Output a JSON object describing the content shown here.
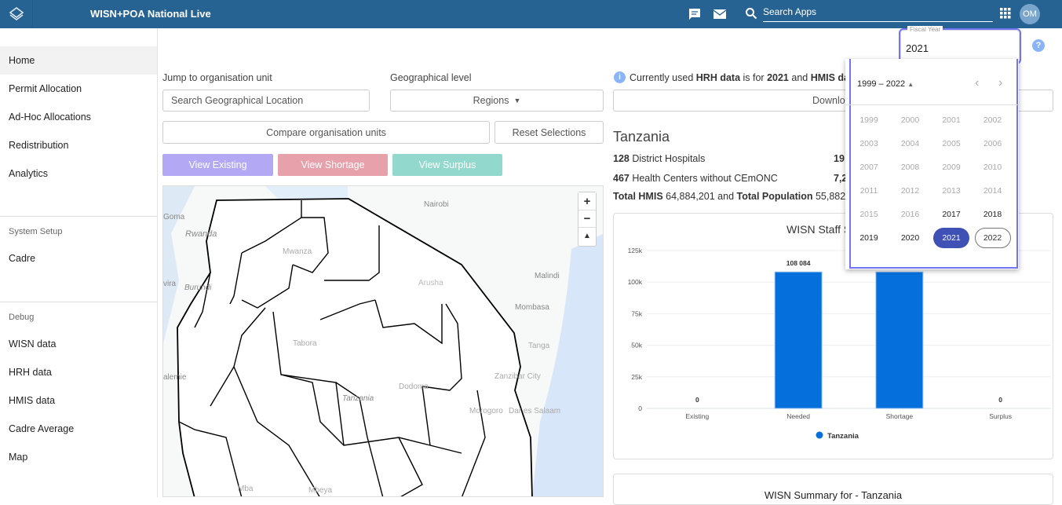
{
  "header": {
    "title": "WISN+POA National Live",
    "search_placeholder": "Search Apps",
    "avatar_initials": "OM",
    "color": "#276392"
  },
  "sidebar": {
    "items": [
      {
        "label": "Home",
        "active": true
      },
      {
        "label": "Permit Allocation"
      },
      {
        "label": "Ad-Hoc Allocations"
      },
      {
        "label": "Redistribution"
      },
      {
        "label": "Analytics"
      }
    ],
    "system_setup": {
      "heading": "System Setup",
      "items": [
        {
          "label": "Cadre"
        }
      ]
    },
    "debug": {
      "heading": "Debug",
      "items": [
        {
          "label": "WISN data"
        },
        {
          "label": "HRH data"
        },
        {
          "label": "HMIS data"
        },
        {
          "label": "Cadre Average"
        },
        {
          "label": "Map"
        }
      ]
    }
  },
  "filters": {
    "jump_label": "Jump to organisation unit",
    "search_placeholder": "Search Geographical Location",
    "geo_label": "Geographical level",
    "geo_value": "Regions",
    "compare": "Compare organisation units",
    "reset": "Reset Selections",
    "view_existing": "View Existing",
    "view_shortage": "View Shortage",
    "view_surplus": "View Surplus"
  },
  "map": {
    "labels": [
      "Nairobi",
      "Rwanda",
      "Goma",
      "Burundi",
      "Mwanza",
      "Arusha",
      "Malindi",
      "Mombasa",
      "Tabora",
      "Tanga",
      "Zanzibar City",
      "Dodoma",
      "Tanzania",
      "Morogoro",
      "Dar es Salaam",
      "Mbeya",
      "Mba",
      "alemie",
      "vira"
    ],
    "zoom_in": "+",
    "zoom_out": "−"
  },
  "info": {
    "p1": "Currently used ",
    "b1": "HRH data",
    "p2": " is for ",
    "b2": "2021",
    "p3": " and ",
    "b3": "HMIS dat",
    "download": "Downlo"
  },
  "summary": {
    "title": "Tanzania",
    "dh_count": "128",
    "dh_label": " District Hospitals",
    "dh_right": "19",
    "hc_count": "467",
    "hc_label": " Health Centers without CEmONC",
    "hc_right": "7,2",
    "hmis_label": "Total HMIS",
    "hmis_value": " 64,884,201 and ",
    "pop_label": "Total Population",
    "pop_value": " 55,882,59"
  },
  "chart_data": {
    "type": "bar",
    "title": "WISN Staff S",
    "categories": [
      "Existing",
      "Needed",
      "Shortage",
      "Surplus"
    ],
    "series": [
      {
        "name": "Tanzania",
        "values": [
          0,
          108084,
          108084,
          0
        ]
      }
    ],
    "data_labels": [
      "0",
      "108 084",
      "",
      "0"
    ],
    "yticks": [
      "0",
      "25k",
      "50k",
      "75k",
      "100k",
      "125k"
    ],
    "ylim": [
      0,
      125000
    ],
    "grid": true,
    "legend": "bottom",
    "color": "#0570dc"
  },
  "summary_card": {
    "title": "WISN Summary for - Tanzania"
  },
  "fiscal": {
    "label": "Fiscal Year",
    "value": "2021",
    "range": "1999 – 2022",
    "years": [
      "1999",
      "2000",
      "2001",
      "2002",
      "2003",
      "2004",
      "2005",
      "2006",
      "2007",
      "2008",
      "2009",
      "2010",
      "2011",
      "2012",
      "2013",
      "2014",
      "2015",
      "2016",
      "2017",
      "2018",
      "2019",
      "2020",
      "2021",
      "2022"
    ],
    "selected": "2021",
    "current": "2022",
    "enabled_from": "2017"
  }
}
